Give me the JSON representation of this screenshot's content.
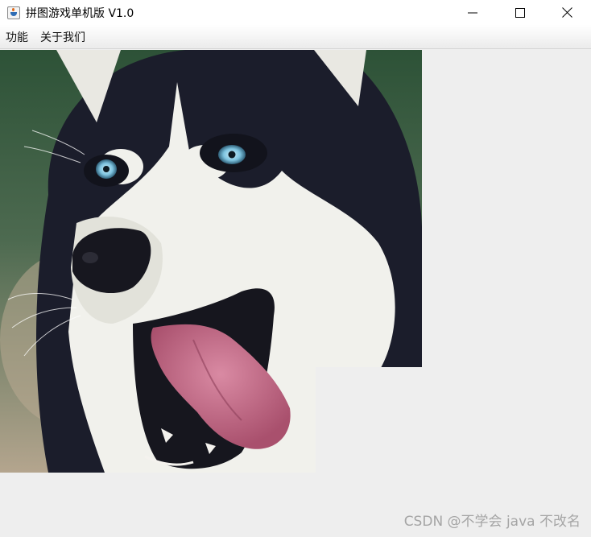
{
  "window": {
    "title": "拼图游戏单机版 V1.0",
    "icon": "java-cup-icon",
    "controls": [
      "minimize-icon",
      "maximize-icon",
      "close-icon"
    ]
  },
  "menubar": {
    "items": [
      {
        "label": "功能"
      },
      {
        "label": "关于我们"
      }
    ]
  },
  "puzzle": {
    "image_subject": "husky",
    "empty_tile": "bottom-right"
  },
  "watermark": {
    "text": "CSDN @不学会 java 不改名"
  },
  "colors": {
    "background": "#eeeeee",
    "titlebar": "#ffffff",
    "fur_dark": "#1b1d2b",
    "fur_light": "#f1f1ec",
    "eye": "#7ec4e0",
    "tongue": "#c9718d"
  }
}
